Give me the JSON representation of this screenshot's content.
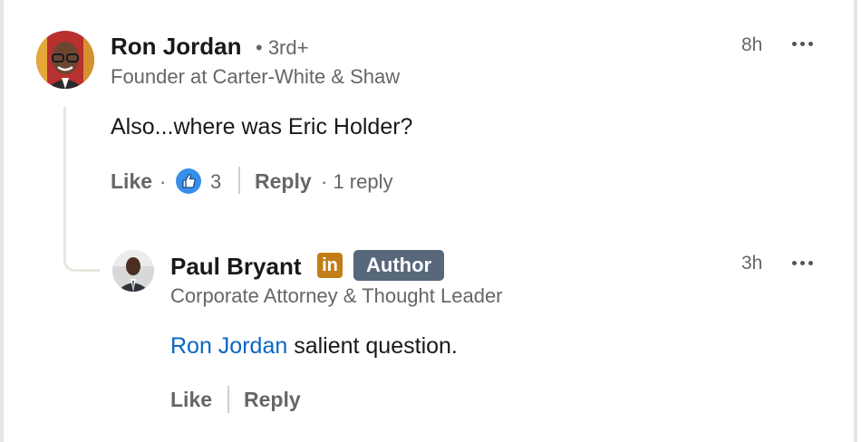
{
  "comment": {
    "author_name": "Ron Jordan",
    "degree": "• 3rd+",
    "headline": "Founder at Carter-White & Shaw",
    "time": "8h",
    "text": "Also...where was Eric Holder?",
    "like_label": "Like",
    "separator": "·",
    "reaction_count": "3",
    "reply_label": "Reply",
    "replies_text": "· 1 reply"
  },
  "reply": {
    "author_name": "Paul Bryant",
    "linkedin_badge": "in",
    "author_badge": "Author",
    "headline": "Corporate Attorney & Thought Leader",
    "time": "3h",
    "mention": "Ron Jordan",
    "text": " salient question.",
    "like_label": "Like",
    "reply_label": "Reply"
  },
  "colors": {
    "link": "#0a66c2",
    "secondary_text": "#666666",
    "author_badge_bg": "#56687a",
    "linkedin_badge_bg": "#c37d16",
    "like_icon": "#378fe9"
  },
  "icons": [
    "more-horizontal-icon",
    "like-reaction-icon",
    "linkedin-premium-icon"
  ]
}
